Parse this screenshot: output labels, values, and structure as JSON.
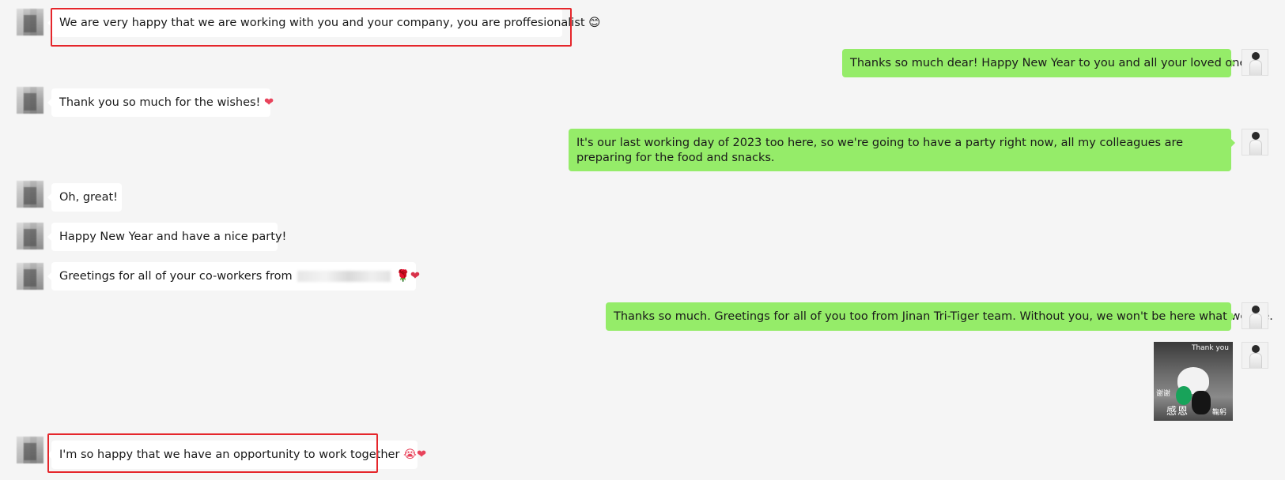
{
  "messages": [
    {
      "side": "left",
      "text": "We are very happy that we are working with you and your company, you are proffesionalist",
      "emoji": "😊"
    },
    {
      "side": "right",
      "text": "Thanks so much dear! Happy New Year to you and all your loved ones."
    },
    {
      "side": "left",
      "text": "Thank you so much for the wishes!",
      "emoji": "❤"
    },
    {
      "side": "right",
      "text": "It's our last working day of 2023 too here, so we're going to have a party right now, all my colleagues are preparing for the food and snacks."
    },
    {
      "side": "left",
      "text": "Oh, great!"
    },
    {
      "side": "left",
      "text": "Happy New Year and have a nice party!"
    },
    {
      "side": "left",
      "text": "Greetings for all of your co-workers from",
      "emoji": "🌹❤"
    },
    {
      "side": "right",
      "text": "Thanks so much. Greetings for all of you too from Jinan Tri-Tiger team. Without you, we won't be here what we are."
    },
    {
      "side": "right",
      "sticker": {
        "caption_top": "Thank you",
        "caption_left": "谢谢",
        "caption_mid": "感恩",
        "caption_right": "鞠躬"
      }
    },
    {
      "side": "left",
      "text": "I'm so happy that we have an opportunity to work together",
      "emoji": "😭❤"
    }
  ],
  "colors": {
    "background": "#f5f5f5",
    "incoming_bubble": "#ffffff",
    "outgoing_bubble": "#95ec69",
    "highlight_border": "#e5262b"
  }
}
